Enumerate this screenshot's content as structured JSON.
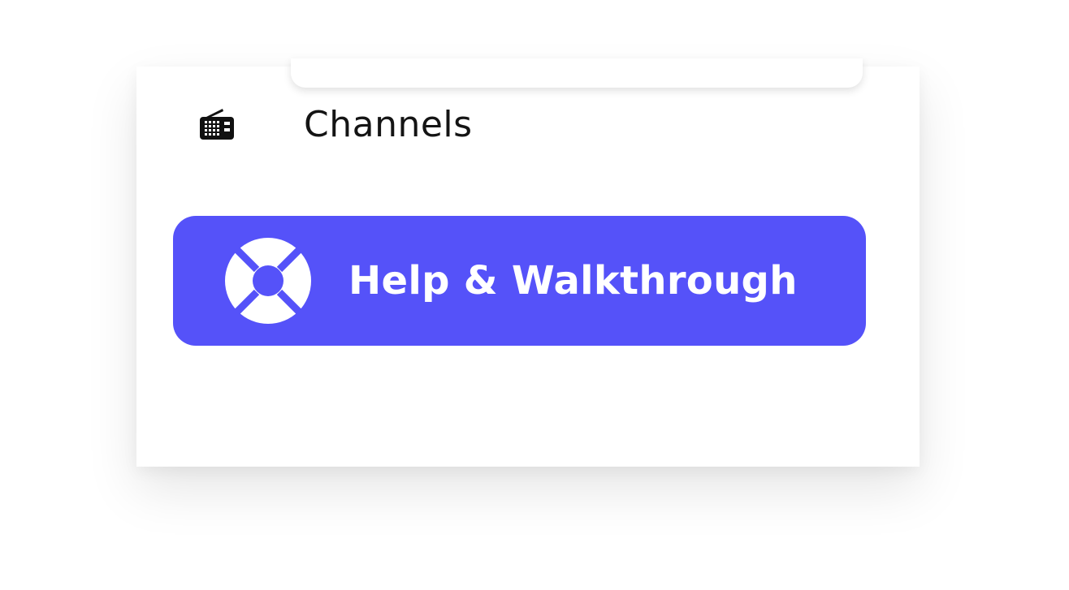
{
  "nav": {
    "channels": {
      "label": "Channels",
      "icon": "radio-icon"
    }
  },
  "help": {
    "label": "Help & Walkthrough",
    "icon": "lifebuoy-icon",
    "background_color": "#5552f9",
    "text_color": "#ffffff"
  }
}
